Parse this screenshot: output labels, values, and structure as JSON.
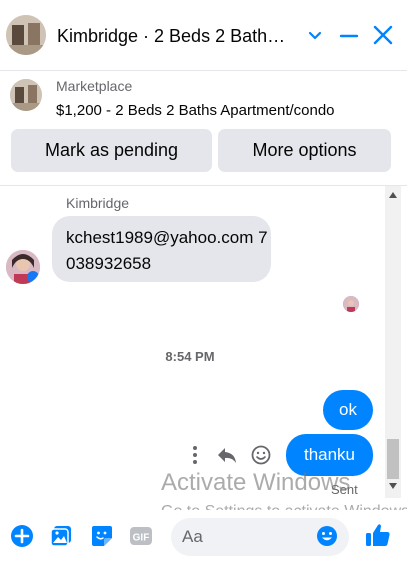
{
  "header": {
    "title": "Kimbridge · 2 Beds 2 Bath…"
  },
  "listing": {
    "source": "Marketplace",
    "title": "$1,200 - 2 Beds 2 Baths Apartment/condo",
    "mark_pending_label": "Mark as pending",
    "more_options_label": "More options"
  },
  "messages": {
    "sender_name": "Kimbridge",
    "incoming_text": "kchest1989@yahoo.com 7038932658",
    "timestamp": "8:54 PM",
    "outgoing": [
      "ok",
      "thanku"
    ],
    "status": "Sent"
  },
  "watermark": {
    "title": "Activate Windows",
    "subtitle": "Go to Settings to activate Windows."
  },
  "composer": {
    "placeholder": "Aa",
    "gif_label": "GIF"
  },
  "colors": {
    "accent": "#0084ff",
    "bubble_in": "#e4e6eb",
    "muted_text": "#65676b"
  },
  "icons": [
    "chevron-down-icon",
    "minimize-icon",
    "close-icon",
    "more-vertical-icon",
    "reply-icon",
    "react-icon",
    "plus-circle-icon",
    "photo-icon",
    "sticker-icon",
    "gif-icon",
    "emoji-icon",
    "thumbs-up-icon"
  ]
}
